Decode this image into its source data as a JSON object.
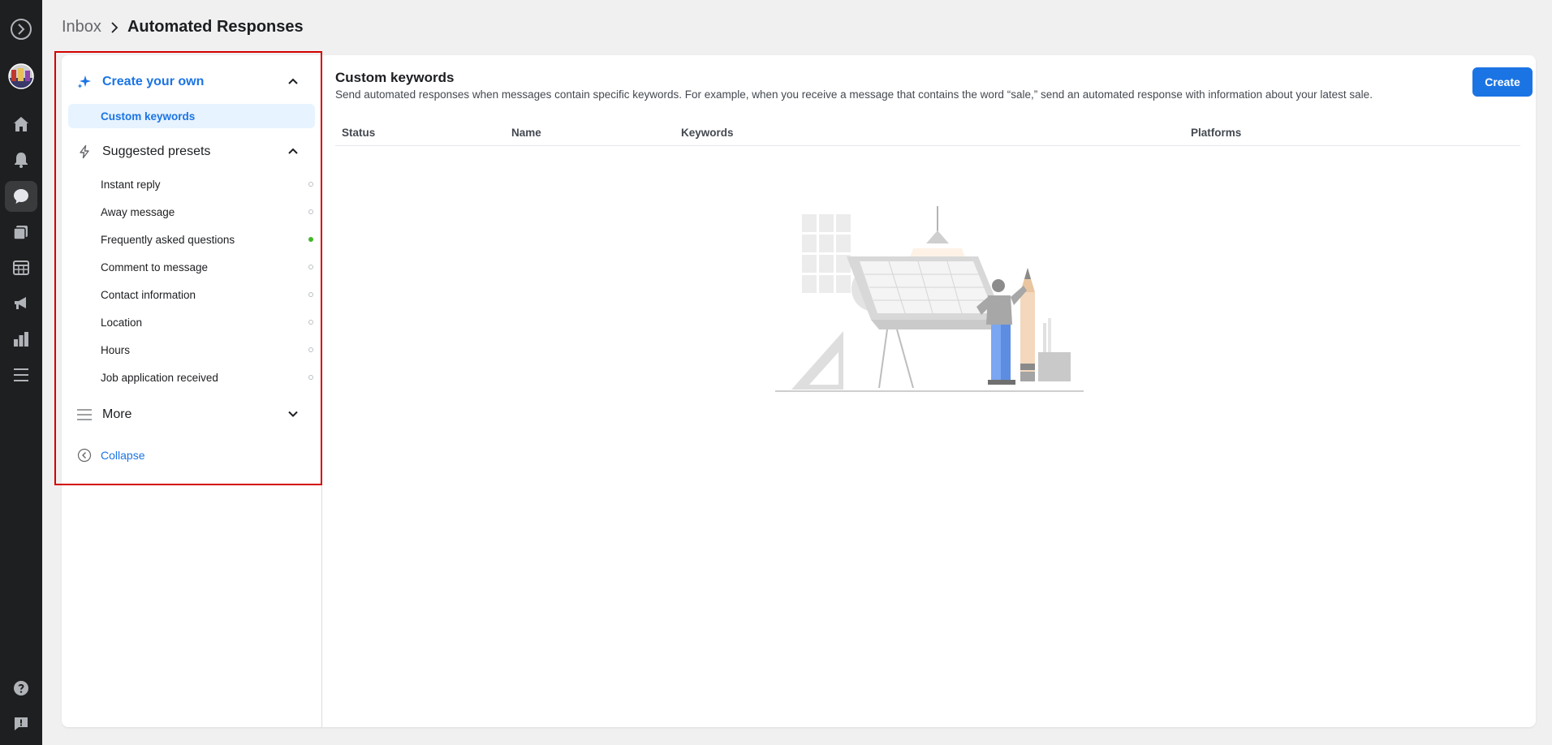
{
  "breadcrumb": {
    "parent": "Inbox",
    "current": "Automated Responses"
  },
  "rail": {
    "icons": [
      "meta-logo-icon",
      "avatar",
      "home-icon",
      "bell-icon",
      "chat-icon",
      "pages-icon",
      "table-icon",
      "megaphone-icon",
      "bar-chart-icon",
      "menu-icon",
      "help-icon",
      "report-icon"
    ],
    "active": "chat-icon"
  },
  "sidebar": {
    "create_section": {
      "label": "Create your own",
      "icon": "sparkle-icon",
      "expanded": true
    },
    "create_items": [
      {
        "label": "Custom keywords",
        "selected": true
      }
    ],
    "presets_section": {
      "label": "Suggested presets",
      "icon": "bolt-icon",
      "expanded": true
    },
    "preset_items": [
      {
        "label": "Instant reply",
        "active": false
      },
      {
        "label": "Away message",
        "active": false
      },
      {
        "label": "Frequently asked questions",
        "active": true
      },
      {
        "label": "Comment to message",
        "active": false
      },
      {
        "label": "Contact information",
        "active": false
      },
      {
        "label": "Location",
        "active": false
      },
      {
        "label": "Hours",
        "active": false
      },
      {
        "label": "Job application received",
        "active": false
      }
    ],
    "more_section": {
      "label": "More",
      "icon": "menu-icon",
      "expanded": false
    },
    "collapse_label": "Collapse"
  },
  "main": {
    "title": "Custom keywords",
    "description": "Send automated responses when messages contain specific keywords. For example, when you receive a message that contains the word “sale,” send an automated response with information about your latest sale.",
    "create_button": "Create",
    "columns": [
      "Status",
      "Name",
      "Keywords",
      "Platforms"
    ]
  },
  "colors": {
    "accent": "#1b74e4",
    "selected_bg": "#e7f3ff",
    "active_dot": "#42b72a",
    "rail_bg": "#1e1f20",
    "highlight": "#d40000"
  }
}
